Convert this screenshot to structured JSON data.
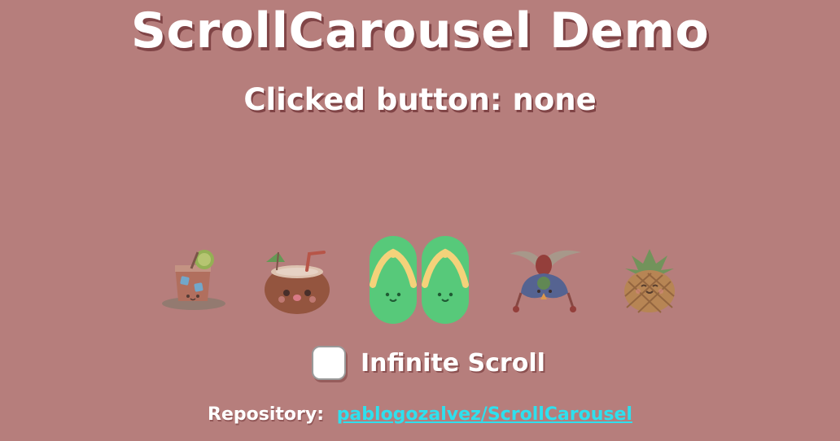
{
  "header": {
    "title": "ScrollCarousel Demo",
    "clicked_text": "Clicked button: none"
  },
  "carousel": {
    "items": [
      {
        "icon": "iced-drink-icon",
        "selected": false
      },
      {
        "icon": "coconut-drink-icon",
        "selected": false
      },
      {
        "icon": "flip-flops-icon",
        "selected": true
      },
      {
        "icon": "cockatoo-bird-icon",
        "selected": false
      },
      {
        "icon": "pineapple-icon",
        "selected": false
      }
    ]
  },
  "options": {
    "infinite_scroll_label": "Infinite Scroll",
    "infinite_scroll_checked": false
  },
  "footer": {
    "repository_label": "Repository:",
    "repository_link": "pablogozalvez/ScrollCarousel"
  },
  "colors": {
    "background": "#b67e7c",
    "link": "#2ee0ee",
    "text": "#ffffff"
  }
}
